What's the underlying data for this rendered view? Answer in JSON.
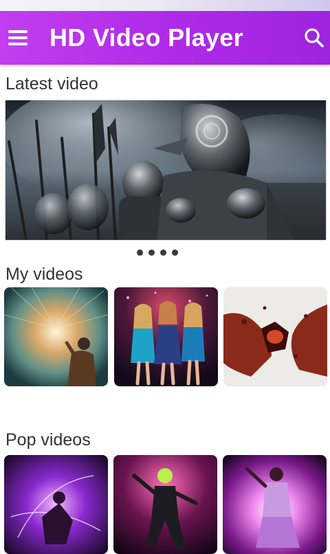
{
  "app_bar": {
    "title": "HD Video Player",
    "menu_icon": "hamburger-menu-icon",
    "search_icon": "search-icon",
    "accent_color": "#b02be8"
  },
  "sections": {
    "latest": {
      "title": "Latest video",
      "carousel_pages": 4
    },
    "my_videos": {
      "title": "My videos",
      "items": [
        "light-portal-man",
        "party-girls",
        "bloody-hands"
      ]
    },
    "pop_videos": {
      "title": "Pop videos",
      "items": [
        "neon-dancer",
        "neon-b-boy",
        "pink-light-dancer"
      ]
    }
  }
}
